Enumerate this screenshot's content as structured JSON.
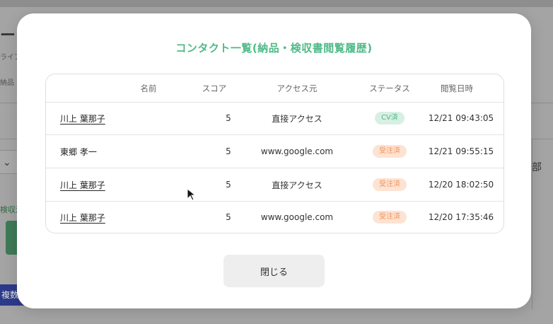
{
  "background": {
    "page_title_fragment": "ート",
    "sub_fragment": "ライア",
    "sub2_fragment": "納品",
    "green_text_fragment": "検収済",
    "blue_button_fragment": "複数",
    "right_fragment": "部"
  },
  "modal": {
    "title": "コンタクト一覧(納品・検収書閲覧履歴)",
    "columns": {
      "name": "名前",
      "score": "スコア",
      "source": "アクセス元",
      "status": "ステータス",
      "date": "閲覧日時"
    },
    "rows": [
      {
        "name": "川上 葉那子",
        "score": "5",
        "source": "直接アクセス",
        "status": "CV済",
        "date": "12/21 09:43:05"
      },
      {
        "name": "東郷 孝一",
        "score": "5",
        "source": "www.google.com",
        "status": "受注済",
        "date": "12/21 09:55:15"
      },
      {
        "name": "川上 葉那子",
        "score": "5",
        "source": "直接アクセス",
        "status": "受注済",
        "date": "12/20 18:02:50"
      },
      {
        "name": "川上 葉那子",
        "score": "5",
        "source": "www.google.com",
        "status": "受注済",
        "date": "12/20 17:35:46"
      }
    ],
    "close_label": "閉じる"
  },
  "colors": {
    "title_green": "#4fba88",
    "badge_cv_bg": "#d8f0e4",
    "badge_order_bg": "#fde3d3",
    "badge_order_text": "#f2955b"
  }
}
